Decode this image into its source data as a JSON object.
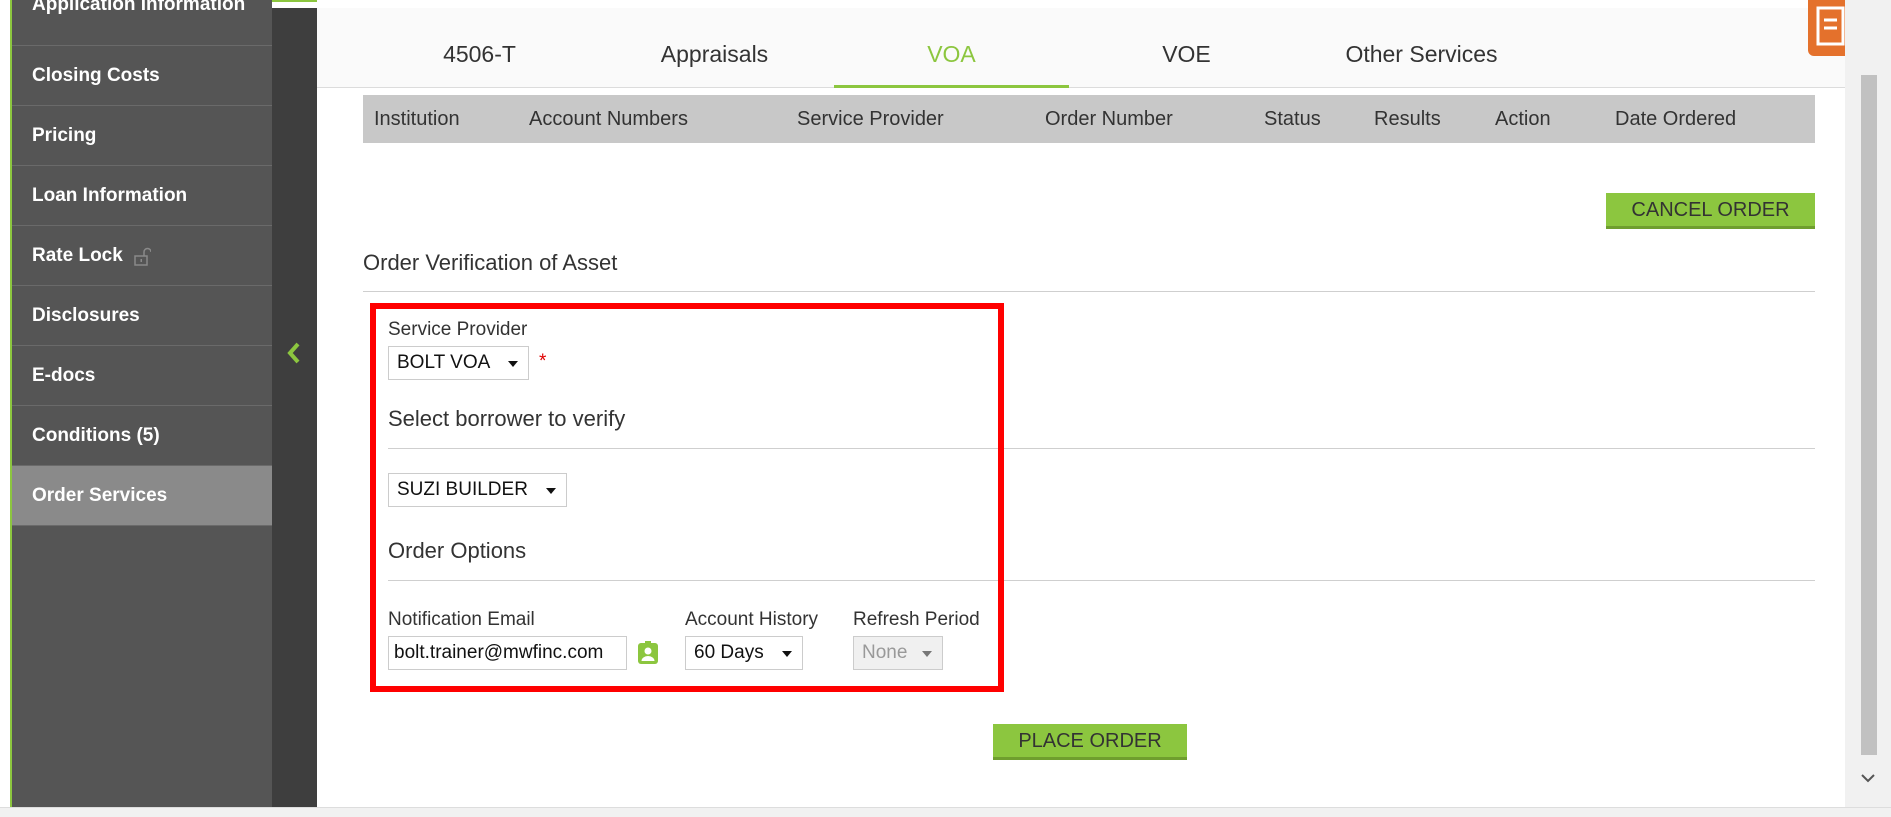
{
  "sidebar": {
    "items": [
      {
        "label": "Application Information"
      },
      {
        "label": "Closing Costs"
      },
      {
        "label": "Pricing"
      },
      {
        "label": "Loan Information"
      },
      {
        "label": "Rate Lock"
      },
      {
        "label": "Disclosures"
      },
      {
        "label": "E-docs"
      },
      {
        "label": "Conditions (5)"
      },
      {
        "label": "Order Services"
      }
    ],
    "active": "Order Services"
  },
  "tabs": [
    {
      "label": "4506-T"
    },
    {
      "label": "Appraisals"
    },
    {
      "label": "VOA"
    },
    {
      "label": "VOE"
    },
    {
      "label": "Other Services"
    }
  ],
  "active_tab": "VOA",
  "table": {
    "columns": [
      "Institution",
      "Account Numbers",
      "Service Provider",
      "Order Number",
      "Status",
      "Results",
      "Action",
      "Date Ordered"
    ]
  },
  "cancel_button": "CANCEL ORDER",
  "order_section": {
    "title": "Order Verification of Asset",
    "service_provider_label": "Service Provider",
    "service_provider_value": "BOLT VOA",
    "required_mark": "*",
    "borrower_title": "Select borrower to verify",
    "borrower_value": "SUZI BUILDER",
    "options_title": "Order Options",
    "notification_email_label": "Notification Email",
    "notification_email_value": "bolt.trainer@mwfinc.com",
    "account_history_label": "Account History",
    "account_history_value": "60 Days",
    "refresh_period_label": "Refresh Period",
    "refresh_period_value": "None"
  },
  "place_button": "PLACE ORDER",
  "colors": {
    "accent_green": "#8cc63f",
    "highlight_red": "#ff0000",
    "sidebar_bg": "#555555",
    "orange": "#e4712c"
  }
}
